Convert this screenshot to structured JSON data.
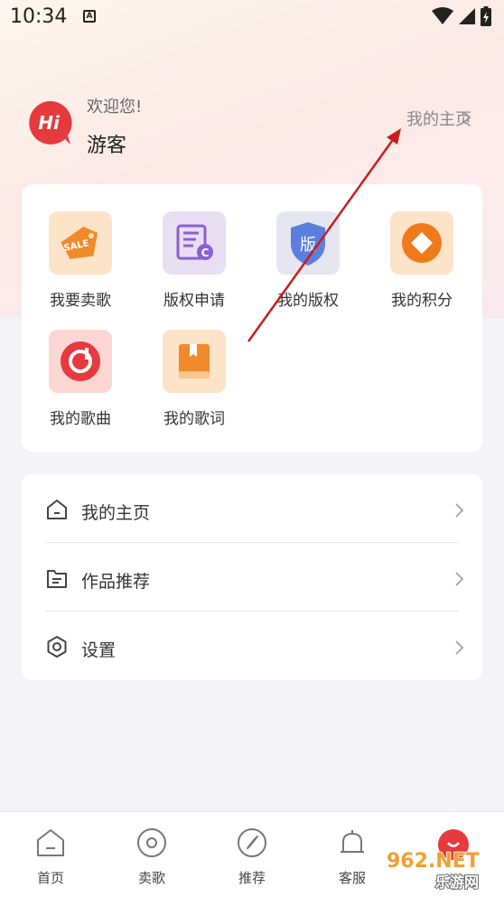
{
  "status_bar": {
    "time": "10:34",
    "notif_glyph": "A"
  },
  "header": {
    "avatar_text": "Hi",
    "welcome": "欢迎您!",
    "username": "游客",
    "homepage_link": "我的主页"
  },
  "grid": [
    {
      "label": "我要卖歌",
      "icon": "sale-tag-icon",
      "badge": "SALE"
    },
    {
      "label": "版权申请",
      "icon": "copyright-apply-icon",
      "badge": "C"
    },
    {
      "label": "我的版权",
      "icon": "copyright-shield-icon",
      "badge": "版"
    },
    {
      "label": "我的积分",
      "icon": "points-coin-icon"
    },
    {
      "label": "我的歌曲",
      "icon": "music-disc-icon"
    },
    {
      "label": "我的歌词",
      "icon": "lyrics-book-icon"
    }
  ],
  "menu": [
    {
      "label": "我的主页",
      "icon": "home-icon"
    },
    {
      "label": "作品推荐",
      "icon": "works-icon"
    },
    {
      "label": "设置",
      "icon": "settings-gear-icon"
    }
  ],
  "bottom_nav": [
    {
      "label": "首页",
      "icon": "home-tab-icon"
    },
    {
      "label": "卖歌",
      "icon": "disc-tab-icon"
    },
    {
      "label": "推荐",
      "icon": "compass-tab-icon"
    },
    {
      "label": "客服",
      "icon": "bell-tab-icon"
    }
  ],
  "watermark": {
    "top": "962.NET",
    "bottom": "乐游网"
  },
  "colors": {
    "accent_red": "#e63a3f",
    "hero_bg": "#fbe9e6",
    "card_bg": "#ffffff"
  }
}
